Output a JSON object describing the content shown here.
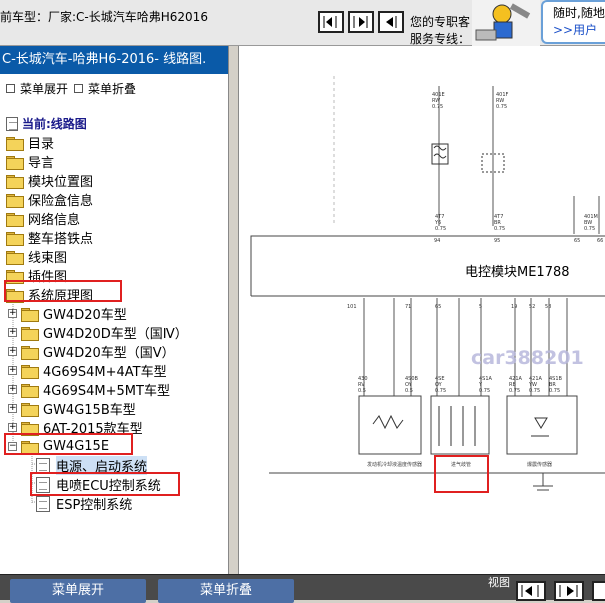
{
  "topbar": {
    "title": "前车型：厂家:C-长城汽车哈弗H62016",
    "service_line1": "您的专职客",
    "service_line2": "服务专线：",
    "ad_line1": "随时,随地",
    "ad_link": ">>用户"
  },
  "left": {
    "header": "C-长城汽车-哈弗H6-2016- 线路图.",
    "expand_label": "菜单展开",
    "collapse_label": "菜单折叠",
    "current": "当前:线路图",
    "items": [
      "目录",
      "导言",
      "模块位置图",
      "保险盒信息",
      "网络信息",
      "整车搭铁点",
      "线束图",
      "插件图",
      "系统原理图"
    ],
    "subitems": [
      "GW4D20车型",
      "GW4D20D车型（国Ⅳ）",
      "GW4D20车型（国Ⅴ）",
      "4G69S4M+4AT车型",
      "4G69S4M+5MT车型",
      "GW4G15B车型",
      "6AT-2015款车型",
      "GW4G15E"
    ],
    "leaves": [
      "电源、启动系统",
      "电喷ECU控制系统",
      "ESP控制系统"
    ]
  },
  "diagram": {
    "module_title": "电控模块ME1788",
    "watermark": "car388201",
    "top_wire_labels": [
      "401E",
      "RW",
      "0.75",
      "401F",
      "RW",
      "0.75"
    ],
    "pins_top": [
      "94",
      "95",
      "65",
      "66"
    ],
    "mid_codes": [
      "4T7",
      "Y6",
      "0.75",
      "4T7",
      "BR",
      "0.75",
      "401M",
      "BW",
      "0.75"
    ],
    "pins_bottom": [
      "101",
      "71",
      "65",
      "5",
      "19",
      "52",
      "58"
    ],
    "bottom_labels": [
      "发动机冷却液温度传感器",
      "进气歧管",
      "爆震传感器"
    ],
    "wire_codes": [
      "430",
      "RV",
      "0.5",
      "4S0B",
      "OY",
      "0.5",
      "4SE",
      "OY",
      "0.75",
      "4S1A",
      "Y",
      "0.75",
      "421A",
      "RB",
      "0.75",
      "421A",
      "YW",
      "0.75",
      "4S1B",
      "BR",
      "0.75"
    ]
  },
  "bottombar": {
    "expand": "菜单展开",
    "collapse": "菜单折叠",
    "view_label": "视图"
  },
  "colors": {
    "header_blue": "#0a5aa8",
    "highlight_red": "#e02020",
    "bottom_button": "#4d6fa5"
  }
}
